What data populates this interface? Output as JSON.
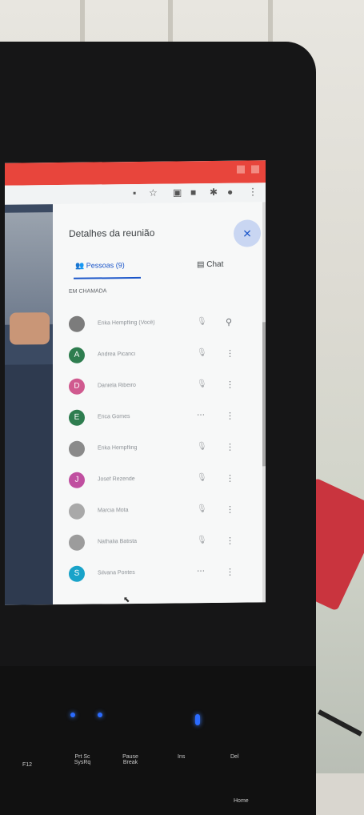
{
  "panel": {
    "title": "Detalhes da reunião",
    "close_icon": "×",
    "tab_people": "Pessoas (9)",
    "tab_chat": "Chat",
    "section_label": "EM CHAMADA"
  },
  "participants": [
    {
      "initial": "",
      "name": "Erika Hempfling (Você)",
      "color": "#7c7c7c",
      "status": "muted"
    },
    {
      "initial": "A",
      "name": "Andrea Picanci",
      "color": "#2e7d4f",
      "status": "muted"
    },
    {
      "initial": "D",
      "name": "Daniela Ribeiro",
      "color": "#d05a8f",
      "status": "muted"
    },
    {
      "initial": "E",
      "name": "Erica Gomes",
      "color": "#2e7d4f",
      "status": "speaking"
    },
    {
      "initial": "",
      "name": "Erika Hempfling",
      "color": "#8a8a8a",
      "status": "muted"
    },
    {
      "initial": "J",
      "name": "Josef Rezende",
      "color": "#c04fa0",
      "status": "muted"
    },
    {
      "initial": "",
      "name": "Marcia Mota",
      "color": "#a9a9a9",
      "status": "muted"
    },
    {
      "initial": "",
      "name": "Nathalia Batista",
      "color": "#9c9c9c",
      "status": "muted"
    },
    {
      "initial": "S",
      "name": "Silvana Pontes",
      "color": "#19a3c9",
      "status": "speaking"
    }
  ],
  "keyboard": {
    "f12": "F12",
    "prtsc": "Prt Sc SysRq",
    "pause": "Pause Break",
    "ins": "Ins",
    "del": "Del",
    "home": "Home"
  }
}
